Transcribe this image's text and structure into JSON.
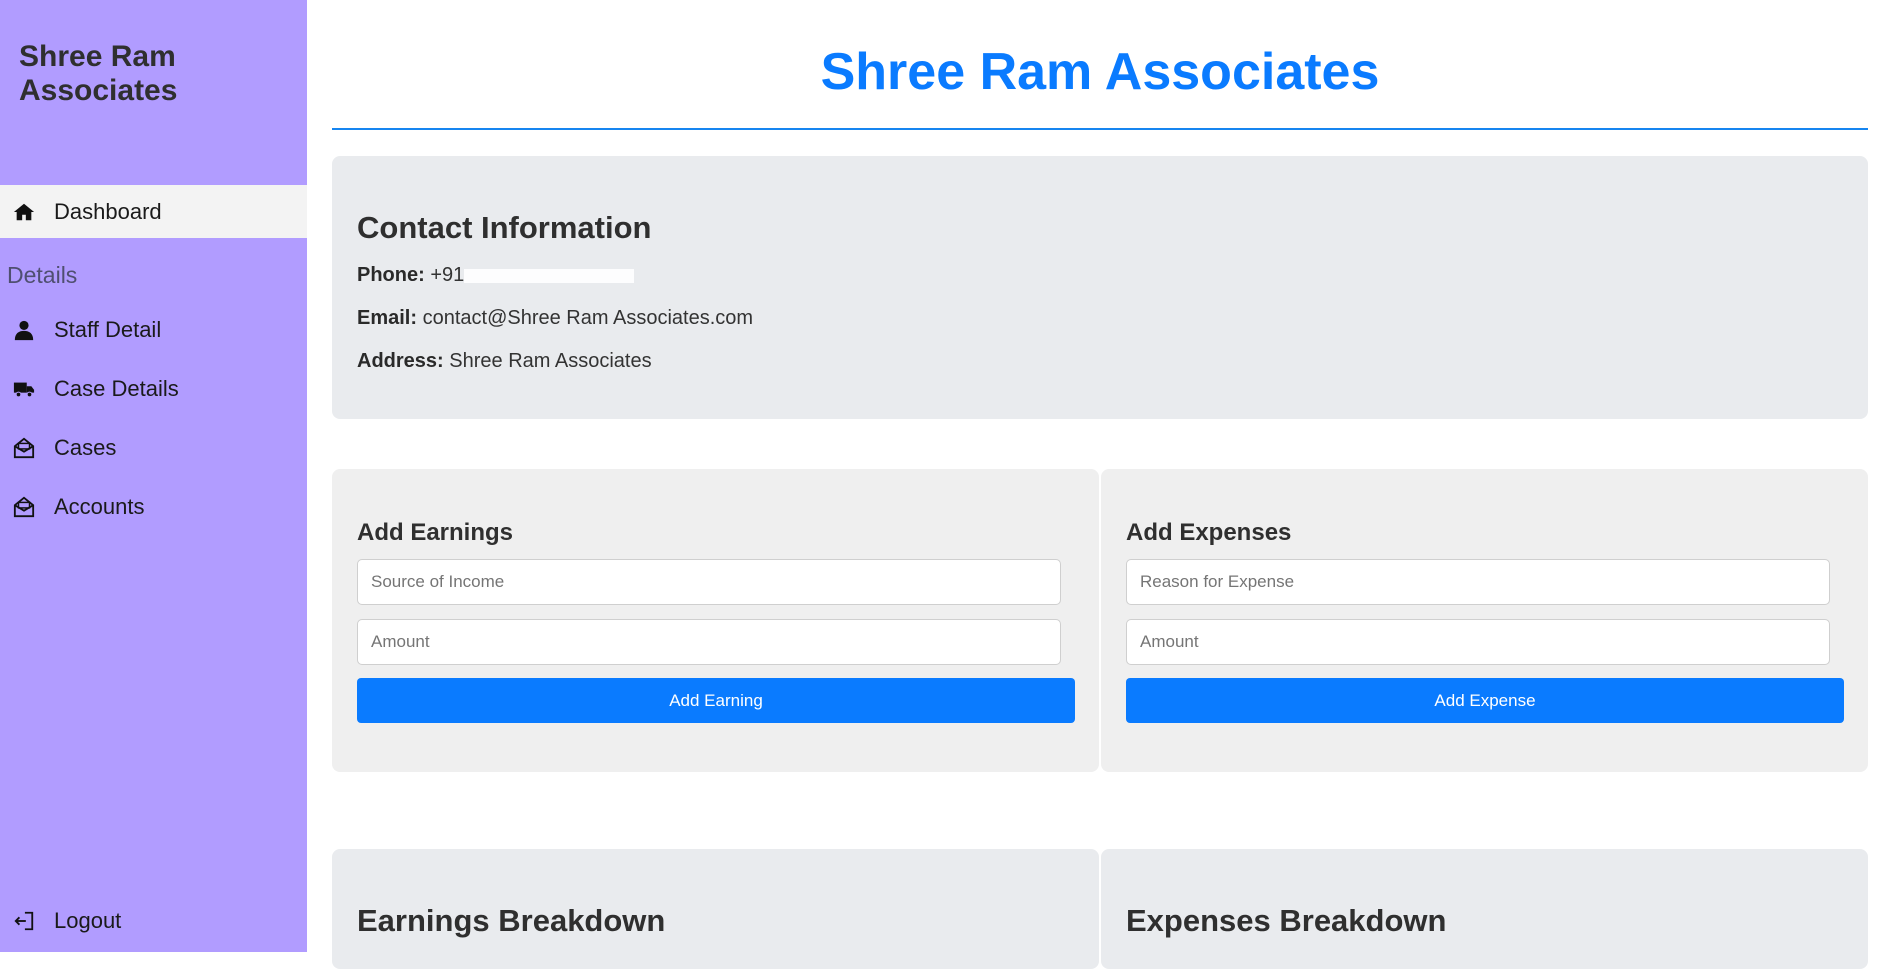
{
  "sidebar": {
    "brand": "Shree Ram Associates",
    "dashboard_label": "Dashboard",
    "section_label": "Details",
    "items": [
      {
        "label": "Staff Detail",
        "icon": "user-icon"
      },
      {
        "label": "Case Details",
        "icon": "truck-icon"
      },
      {
        "label": "Cases",
        "icon": "envelope-open-icon"
      },
      {
        "label": "Accounts",
        "icon": "envelope-open-icon"
      }
    ],
    "logout_label": "Logout"
  },
  "header": {
    "title": "Shree Ram Associates"
  },
  "contact": {
    "title": "Contact Information",
    "phone_label": "Phone:",
    "phone_value": "+91",
    "email_label": "Email:",
    "email_value": "contact@Shree Ram Associates.com",
    "address_label": "Address:",
    "address_value": "Shree Ram Associates"
  },
  "earnings_form": {
    "title": "Add Earnings",
    "source_placeholder": "Source of Income",
    "amount_placeholder": "Amount",
    "button_label": "Add Earning"
  },
  "expenses_form": {
    "title": "Add Expenses",
    "reason_placeholder": "Reason for Expense",
    "amount_placeholder": "Amount",
    "button_label": "Add Expense"
  },
  "breakdown": {
    "earnings_title": "Earnings Breakdown",
    "expenses_title": "Expenses Breakdown"
  },
  "colors": {
    "sidebar_bg": "#b19cff",
    "accent": "#0a7bff",
    "card_bg": "#e9ebee"
  }
}
